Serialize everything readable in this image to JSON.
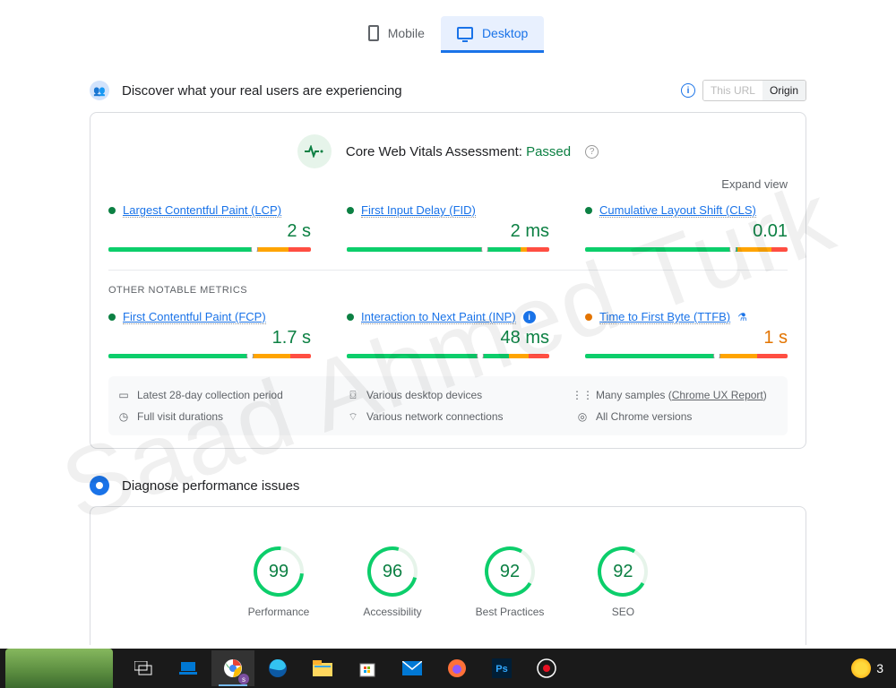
{
  "tabs": {
    "mobile": "Mobile",
    "desktop": "Desktop"
  },
  "section1": {
    "title": "Discover what your real users are experiencing",
    "toggle": {
      "url": "This URL",
      "origin": "Origin"
    }
  },
  "assessment": {
    "label": "Core Web Vitals Assessment:",
    "status": "Passed"
  },
  "expand": "Expand view",
  "metrics_main": [
    {
      "name": "Largest Contentful Paint (LCP)",
      "value": "2 s",
      "status": "green",
      "bar": {
        "g": 72,
        "o": 17,
        "r": 11
      },
      "marker": 72
    },
    {
      "name": "First Input Delay (FID)",
      "value": "2 ms",
      "status": "green",
      "bar": {
        "g": 86,
        "o": 3,
        "r": 11
      },
      "marker": 68
    },
    {
      "name": "Cumulative Layout Shift (CLS)",
      "value": "0.01",
      "status": "green",
      "bar": {
        "g": 75,
        "o": 17,
        "r": 8
      },
      "marker": 73
    }
  ],
  "subhead": "OTHER NOTABLE METRICS",
  "metrics_other": [
    {
      "name": "First Contentful Paint (FCP)",
      "value": "1.7 s",
      "status": "green",
      "bar": {
        "g": 70,
        "o": 20,
        "r": 10
      },
      "marker": 70,
      "badge": ""
    },
    {
      "name": "Interaction to Next Paint (INP)",
      "value": "48 ms",
      "status": "green",
      "bar": {
        "g": 80,
        "o": 10,
        "r": 10
      },
      "marker": 66,
      "badge": "info"
    },
    {
      "name": "Time to First Byte (TTFB)",
      "value": "1 s",
      "status": "orange",
      "bar": {
        "g": 65,
        "o": 20,
        "r": 15
      },
      "marker": 65,
      "badge": "flask"
    }
  ],
  "footer": {
    "period": "Latest 28-day collection period",
    "devices": "Various desktop devices",
    "samples": "Many samples",
    "samples_link": "Chrome UX Report",
    "durations": "Full visit durations",
    "network": "Various network connections",
    "chrome": "All Chrome versions"
  },
  "section2": {
    "title": "Diagnose performance issues"
  },
  "scores": [
    {
      "value": "99",
      "label": "Performance",
      "rot": 50
    },
    {
      "value": "96",
      "label": "Accessibility",
      "rot": 60
    },
    {
      "value": "92",
      "label": "Best Practices",
      "rot": 75
    },
    {
      "value": "92",
      "label": "SEO",
      "rot": 75
    }
  ],
  "watermark": "Saad Ahmed Turk",
  "taskbar": {
    "temp": "3"
  }
}
